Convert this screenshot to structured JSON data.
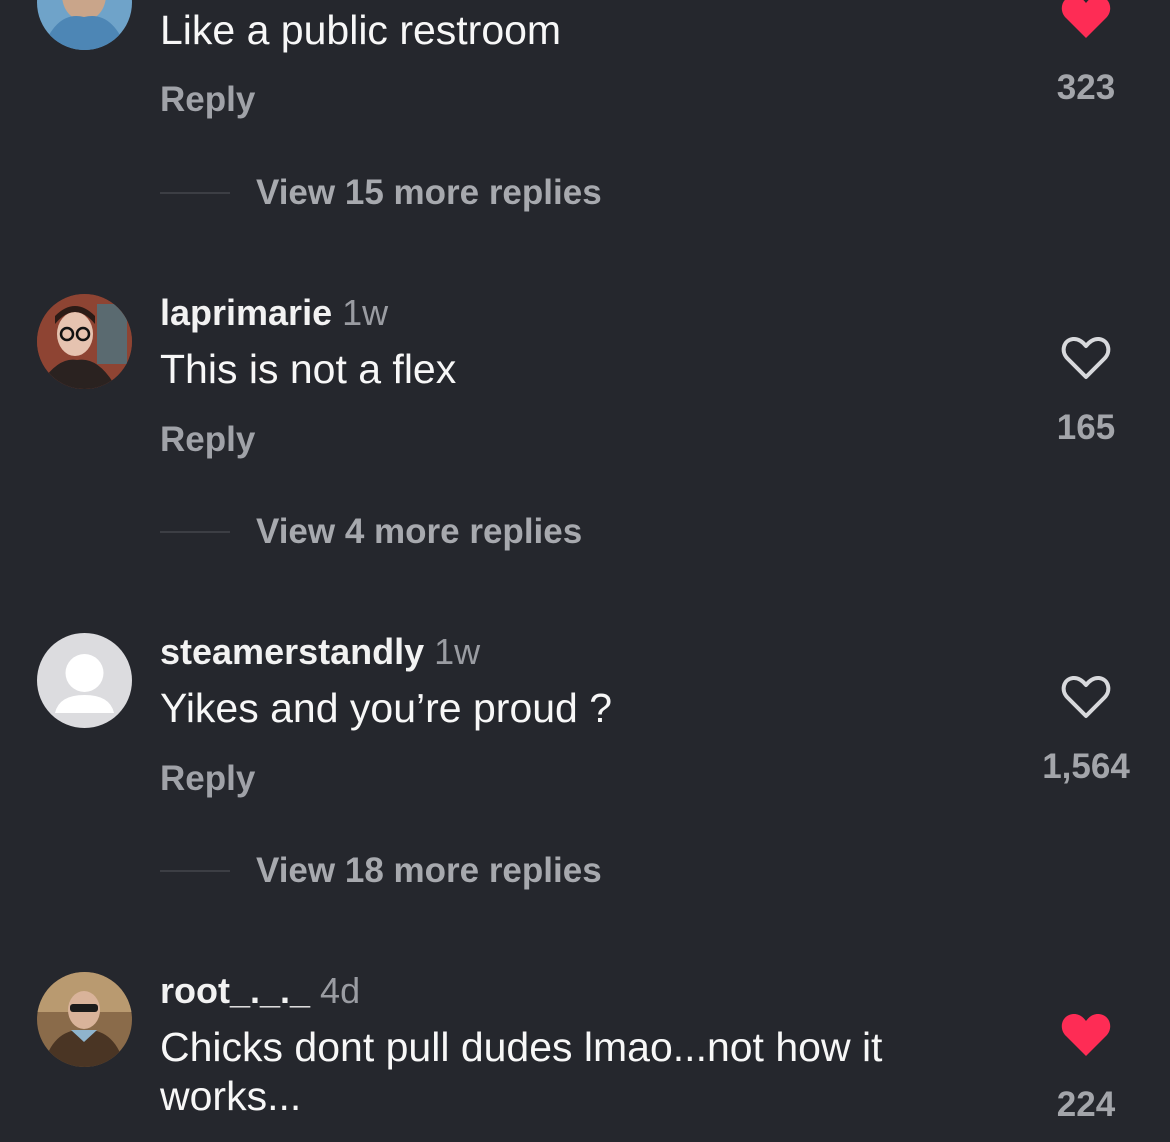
{
  "comments": [
    {
      "text": "Like a public restroom",
      "reply_label": "Reply",
      "view_replies": "View 15 more replies",
      "likes": "323",
      "liked": true,
      "icon": "heart-filled-icon"
    },
    {
      "username": "laprimarie",
      "time": "1w",
      "text": "This is not a flex",
      "reply_label": "Reply",
      "view_replies": "View 4 more replies",
      "likes": "165",
      "liked": false,
      "icon": "heart-outline-icon"
    },
    {
      "username": "steamerstandly",
      "time": "1w",
      "text": "Yikes and you’re proud ?",
      "reply_label": "Reply",
      "view_replies": "View 18 more replies",
      "likes": "1,564",
      "liked": false,
      "icon": "heart-outline-icon"
    },
    {
      "username": "root_._._",
      "time": "4d",
      "text": "Chicks dont pull dudes lmao...not how it works...",
      "likes": "224",
      "liked": true,
      "icon": "heart-filled-icon"
    }
  ],
  "colors": {
    "background": "#25272d",
    "like_red": "#fe2c55"
  }
}
